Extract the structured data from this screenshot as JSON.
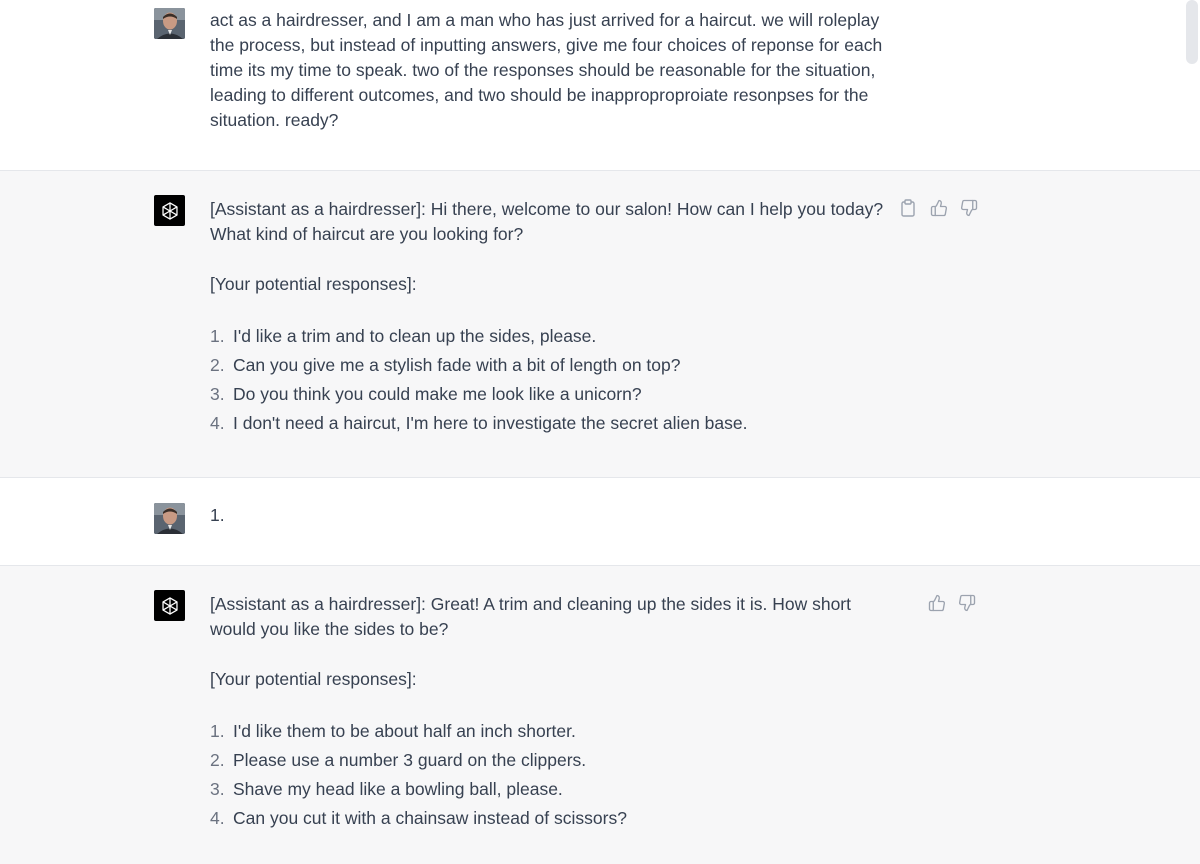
{
  "conversation": {
    "m1": {
      "role": "user",
      "text": "act as a hairdresser, and I am a man who has just arrived for a haircut. we will roleplay the process, but instead of inputting answers, give me four choices of reponse for each time its my time to speak. two of the responses should be reasonable for the situation, leading to different outcomes, and two should be inapproproproiate resonpses for the situation. ready?"
    },
    "m2": {
      "role": "assistant",
      "intro": "[Assistant as a hairdresser]: Hi there, welcome to our salon! How can I help you today? What kind of haircut are you looking for?",
      "responses_label": "[Your potential responses]:",
      "responses": [
        {
          "num": "1.",
          "text": "I'd like a trim and to clean up the sides, please."
        },
        {
          "num": "2.",
          "text": "Can you give me a stylish fade with a bit of length on top?"
        },
        {
          "num": "3.",
          "text": "Do you think you could make me look like a unicorn?"
        },
        {
          "num": "4.",
          "text": "I don't need a haircut, I'm here to investigate the secret alien base."
        }
      ]
    },
    "m3": {
      "role": "user",
      "text": "1."
    },
    "m4": {
      "role": "assistant",
      "intro": "[Assistant as a hairdresser]: Great! A trim and cleaning up the sides it is. How short would you like the sides to be?",
      "responses_label": "[Your potential responses]:",
      "responses": [
        {
          "num": "1.",
          "text": "I'd like them to be about half an inch shorter."
        },
        {
          "num": "2.",
          "text": "Please use a number 3 guard on the clippers."
        },
        {
          "num": "3.",
          "text": "Shave my head like a bowling ball, please."
        },
        {
          "num": "4.",
          "text": "Can you cut it with a chainsaw instead of scissors?"
        }
      ]
    }
  },
  "icons": {
    "copy": "clipboard-icon",
    "up": "thumbs-up-icon",
    "down": "thumbs-down-icon",
    "bot": "openai-logo-icon",
    "user": "user-avatar"
  },
  "colors": {
    "assistant_bg": "#f7f7f8",
    "text": "#374151",
    "icon": "#9ca3af"
  }
}
